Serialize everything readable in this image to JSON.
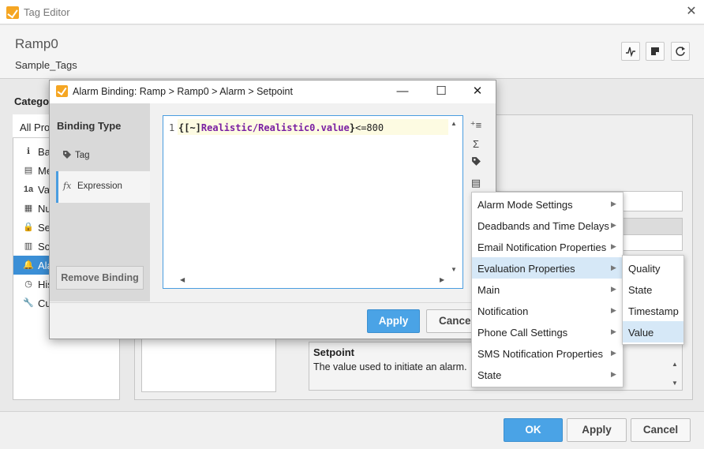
{
  "window": {
    "title": "Tag Editor",
    "close": "✕"
  },
  "tag": {
    "name": "Ramp0",
    "provider": "Sample_Tags"
  },
  "categories": {
    "heading": "Catego",
    "dropdown": "All Pro",
    "items": [
      {
        "icon": "ℹ",
        "label": "Ba"
      },
      {
        "icon": "▤",
        "label": "Me"
      },
      {
        "icon": "1a",
        "label": "Va"
      },
      {
        "icon": "▦",
        "label": "Nu"
      },
      {
        "icon": "🔒",
        "label": "Se"
      },
      {
        "icon": "▥",
        "label": "Sc"
      },
      {
        "icon": "🔔",
        "label": "Ala"
      },
      {
        "icon": "◷",
        "label": "His"
      },
      {
        "icon": "🔧",
        "label": "Cu"
      }
    ]
  },
  "help": {
    "title": "Setpoint",
    "text": "The value used to initiate an alarm."
  },
  "modal": {
    "title": "Alarm Binding: Ramp > Ramp0 > Alarm > Setpoint",
    "binding_type_heading": "Binding Type",
    "tag_option": "Tag",
    "expression_option": "Expression",
    "expression_icon": "fx",
    "remove_binding": "Remove Binding",
    "apply": "Apply",
    "cancel": "Cancel",
    "editor": {
      "line_number": "1",
      "code_open": "{[~]",
      "code_path": "Realistic/Realistic0.value",
      "code_close": "}",
      "code_op": "<=800"
    }
  },
  "menu": {
    "items": [
      "Alarm Mode Settings",
      "Deadbands and Time Delays",
      "Email Notification Properties",
      "Evaluation Properties",
      "Main",
      "Notification",
      "Phone Call Settings",
      "SMS Notification Properties",
      "State"
    ],
    "highlighted": "Evaluation Properties",
    "submenu": [
      "Quality",
      "State",
      "Timestamp",
      "Value"
    ],
    "submenu_highlighted": "Value"
  },
  "footer": {
    "ok": "OK",
    "apply": "Apply",
    "cancel": "Cancel"
  },
  "colors": {
    "accent": "#4aa3e6",
    "selection": "#3b8fd6",
    "menu_highlight": "#d6e8f7",
    "tag_path": "#7a1fa2"
  }
}
